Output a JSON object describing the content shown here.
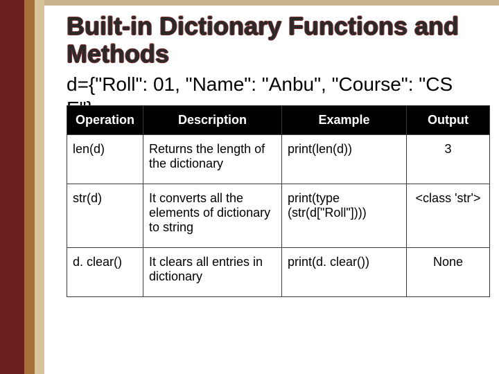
{
  "title": "Built-in Dictionary Functions and Methods",
  "code_line1": "d={\"Roll\": 01, \"Name\": \"Anbu\", \"Course\": \"CS",
  "code_line2": "E\"}",
  "headers": {
    "op": "Operation",
    "desc": "Description",
    "ex": "Example",
    "out": "Output"
  },
  "rows": [
    {
      "op": "len(d)",
      "desc": "Returns the length of the dictionary",
      "ex": "print(len(d))",
      "out": "3"
    },
    {
      "op": "str(d)",
      "desc": "It converts all the elements of dictionary to string",
      "ex": "print(type\n   (str(d[\"Roll\"])))",
      "out": "<class 'str'>"
    },
    {
      "op": "d. clear()",
      "desc": "It clears all entries in dictionary",
      "ex": "print(d. clear())",
      "out": "None"
    }
  ]
}
